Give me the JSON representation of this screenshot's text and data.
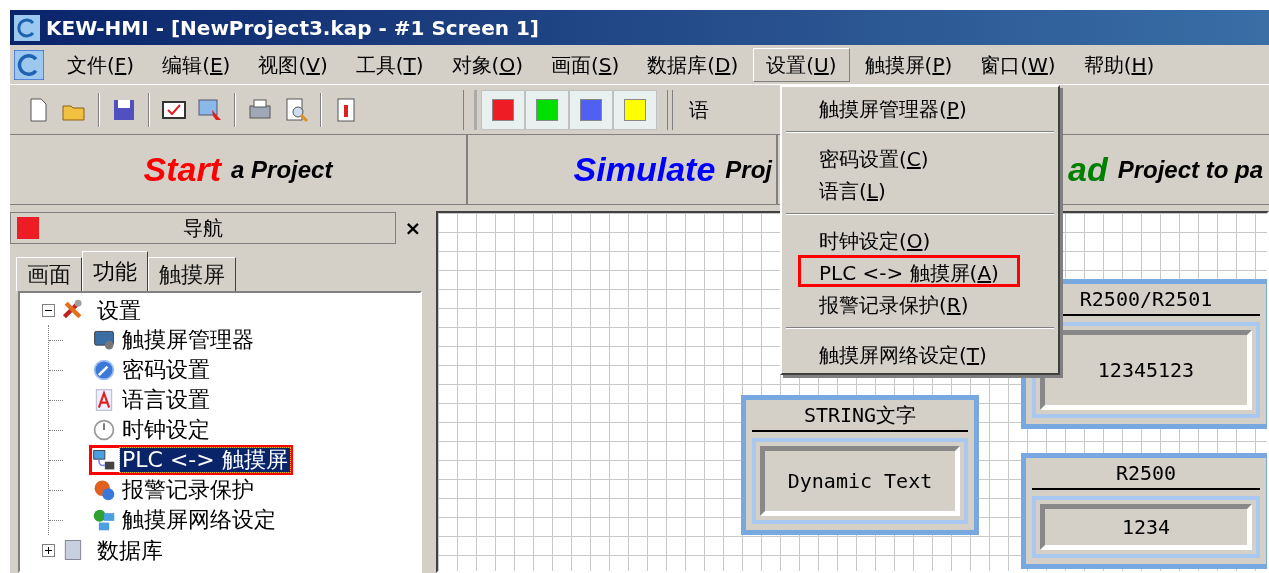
{
  "window": {
    "title": "KEW-HMI - [NewProject3.kap - #1 Screen 1]"
  },
  "menu_bar": [
    {
      "label": "文件(F)",
      "selected": false
    },
    {
      "label": "编辑(E)",
      "selected": false
    },
    {
      "label": "视图(V)",
      "selected": false
    },
    {
      "label": "工具(T)",
      "selected": false
    },
    {
      "label": "对象(O)",
      "selected": false
    },
    {
      "label": "画面(S)",
      "selected": false
    },
    {
      "label": "数据库(D)",
      "selected": false
    },
    {
      "label": "设置(U)",
      "selected": true
    },
    {
      "label": "触摸屏(P)",
      "selected": false
    },
    {
      "label": "窗口(W)",
      "selected": false
    },
    {
      "label": "帮助(H)",
      "selected": false
    }
  ],
  "toolbar": {
    "color_buttons": [
      {
        "color": "#ee1c24"
      },
      {
        "color": "#00e000"
      },
      {
        "color": "#5060f0"
      },
      {
        "color": "#ffff00"
      }
    ],
    "language_label": "语"
  },
  "banner": [
    {
      "kind": "start",
      "word": "Start",
      "rest": "a Project"
    },
    {
      "kind": "simulate",
      "word": "Simulate",
      "rest": "Proj"
    },
    {
      "kind": "download",
      "word": "ad",
      "rest": "Project to pa"
    }
  ],
  "navigator": {
    "title": "导航",
    "close": "×",
    "tabs": [
      {
        "label": "画面",
        "selected": false
      },
      {
        "label": "功能",
        "selected": true
      },
      {
        "label": "触摸屏",
        "selected": false
      }
    ],
    "tree": [
      {
        "label": "设置",
        "kind": "tools",
        "expanded": true,
        "children": [
          {
            "label": "触摸屏管理器",
            "kind": "monitor",
            "selected": false,
            "annotated": false
          },
          {
            "label": "密码设置",
            "kind": "key",
            "selected": false,
            "annotated": false
          },
          {
            "label": "语言设置",
            "kind": "letter",
            "selected": false,
            "annotated": false
          },
          {
            "label": "时钟设定",
            "kind": "clock",
            "selected": false,
            "annotated": false
          },
          {
            "label": "PLC <-> 触摸屏",
            "kind": "link",
            "selected": true,
            "annotated": true
          },
          {
            "label": "报警记录保护",
            "kind": "alarm",
            "selected": false,
            "annotated": false
          },
          {
            "label": "触摸屏网络设定",
            "kind": "network",
            "selected": false,
            "annotated": false
          }
        ]
      },
      {
        "label": "数据库",
        "kind": "database",
        "expanded": false
      }
    ]
  },
  "settings_menu": [
    {
      "kind": "item",
      "label": "触摸屏管理器(P)",
      "annotated": false
    },
    {
      "kind": "separator"
    },
    {
      "kind": "item",
      "label": "密码设置(C)",
      "annotated": false
    },
    {
      "kind": "item",
      "label": "语言(L)",
      "annotated": false
    },
    {
      "kind": "separator"
    },
    {
      "kind": "item",
      "label": "时钟设定(O)",
      "annotated": false
    },
    {
      "kind": "item",
      "label": "PLC <-> 触摸屏(A)",
      "annotated": true
    },
    {
      "kind": "item",
      "label": "报警记录保护(R)",
      "annotated": false
    },
    {
      "kind": "separator"
    },
    {
      "kind": "item",
      "label": "触摸屏网络设定(T)",
      "annotated": false
    }
  ],
  "canvas_widgets": [
    {
      "kind": "string",
      "title": "STRING文字",
      "value": "Dynamic Text"
    },
    {
      "kind": "numeric_top",
      "title": "R2500/R2501",
      "value": "12345123"
    },
    {
      "kind": "numeric_bottom",
      "title": "R2500",
      "value": "1234"
    }
  ]
}
